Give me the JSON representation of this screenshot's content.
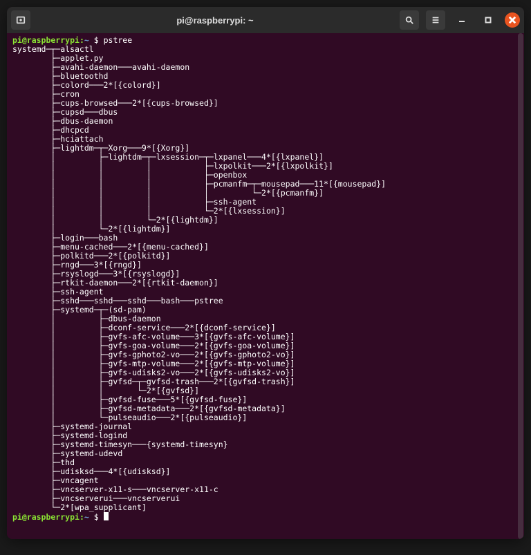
{
  "window": {
    "title": "pi@raspberrypi: ~"
  },
  "prompt": {
    "user_host": "pi@raspberrypi",
    "sep": ":",
    "path": "~",
    "dollar": " $ "
  },
  "command": "pstree",
  "tree": [
    "systemd─┬─alsactl",
    "        ├─applet.py",
    "        ├─avahi-daemon───avahi-daemon",
    "        ├─bluetoothd",
    "        ├─colord───2*[{colord}]",
    "        ├─cron",
    "        ├─cups-browsed───2*[{cups-browsed}]",
    "        ├─cupsd───dbus",
    "        ├─dbus-daemon",
    "        ├─dhcpcd",
    "        ├─hciattach",
    "        ├─lightdm─┬─Xorg───9*[{Xorg}]",
    "        │         ├─lightdm─┬─lxsession─┬─lxpanel───4*[{lxpanel}]",
    "        │         │         │           ├─lxpolkit───2*[{lxpolkit}]",
    "        │         │         │           ├─openbox",
    "        │         │         │           ├─pcmanfm─┬─mousepad───11*[{mousepad}]",
    "        │         │         │           │         └─2*[{pcmanfm}]",
    "        │         │         │           ├─ssh-agent",
    "        │         │         │           └─2*[{lxsession}]",
    "        │         │         └─2*[{lightdm}]",
    "        │         └─2*[{lightdm}]",
    "        ├─login───bash",
    "        ├─menu-cached───2*[{menu-cached}]",
    "        ├─polkitd───2*[{polkitd}]",
    "        ├─rngd───3*[{rngd}]",
    "        ├─rsyslogd───3*[{rsyslogd}]",
    "        ├─rtkit-daemon───2*[{rtkit-daemon}]",
    "        ├─ssh-agent",
    "        ├─sshd───sshd───sshd───bash───pstree",
    "        ├─systemd─┬─(sd-pam)",
    "        │         ├─dbus-daemon",
    "        │         ├─dconf-service───2*[{dconf-service}]",
    "        │         ├─gvfs-afc-volume───3*[{gvfs-afc-volume}]",
    "        │         ├─gvfs-goa-volume───2*[{gvfs-goa-volume}]",
    "        │         ├─gvfs-gphoto2-vo───2*[{gvfs-gphoto2-vo}]",
    "        │         ├─gvfs-mtp-volume───2*[{gvfs-mtp-volume}]",
    "        │         ├─gvfs-udisks2-vo───2*[{gvfs-udisks2-vo}]",
    "        │         ├─gvfsd─┬─gvfsd-trash───2*[{gvfsd-trash}]",
    "        │         │       └─2*[{gvfsd}]",
    "        │         ├─gvfsd-fuse───5*[{gvfsd-fuse}]",
    "        │         ├─gvfsd-metadata───2*[{gvfsd-metadata}]",
    "        │         └─pulseaudio───2*[{pulseaudio}]",
    "        ├─systemd-journal",
    "        ├─systemd-logind",
    "        ├─systemd-timesyn───{systemd-timesyn}",
    "        ├─systemd-udevd",
    "        ├─thd",
    "        ├─udisksd───4*[{udisksd}]",
    "        ├─vncagent",
    "        ├─vncserver-x11-s───vncserver-x11-c",
    "        ├─vncserverui───vncserverui",
    "        └─2*[wpa_supplicant]"
  ]
}
